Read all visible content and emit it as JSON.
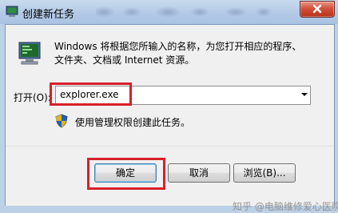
{
  "window": {
    "title": "创建新任务",
    "icons": {
      "title": "run-window-icon",
      "close": "close-icon"
    }
  },
  "content": {
    "description_line1": "Windows 将根据您所输入的名称，为您打开相应的程序、",
    "description_line2": "文件夹、文档或 Internet 资源。",
    "open_label": "打开(O):",
    "open_value": "explorer.exe",
    "admin_text": "使用管理权限创建此任务。",
    "icons": {
      "run": "run-program-icon",
      "shield": "uac-shield-icon",
      "dropdown": "chevron-down-icon"
    }
  },
  "buttons": {
    "ok": "确定",
    "cancel": "取消",
    "browse": "浏览(B)..."
  },
  "watermark": "知乎 @电脑维修爱心医院",
  "colors": {
    "highlight": "#d8202a",
    "close_button": "#c7432d",
    "title_bar": "#b3cae6"
  }
}
